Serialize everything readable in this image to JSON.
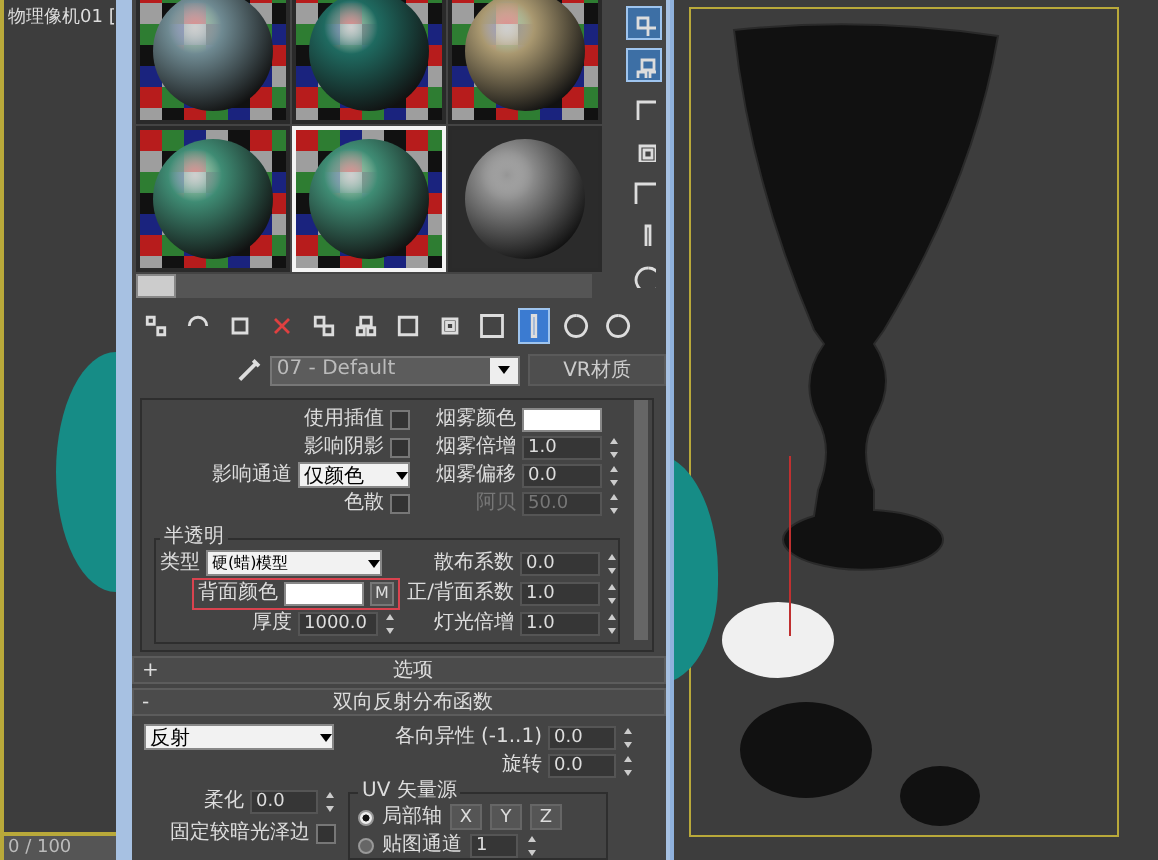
{
  "left_viewport": {
    "label": "物理像机01 [",
    "frame_counter": "0 / 100"
  },
  "material_editor": {
    "sample_slots": [
      {
        "kind": "checker",
        "color": "#6f8a92",
        "selected": false
      },
      {
        "kind": "checker",
        "color": "#1f6a60",
        "selected": false
      },
      {
        "kind": "checker",
        "color": "#a99870",
        "selected": false
      },
      {
        "kind": "checker",
        "color": "#3f8c74",
        "selected": false
      },
      {
        "kind": "checker",
        "color": "#3f8c74",
        "selected": true
      },
      {
        "kind": "plain",
        "color": "#8a8a8a",
        "selected": false
      }
    ],
    "side_toolbar": [
      {
        "selected": true
      },
      {
        "selected": true
      },
      {
        "selected": false
      },
      {
        "selected": false
      },
      {
        "selected": false
      },
      {
        "selected": false
      },
      {
        "selected": false
      }
    ],
    "toolbar": [
      {
        "selected": false
      },
      {
        "selected": false
      },
      {
        "selected": false
      },
      {
        "selected": false
      },
      {
        "selected": false
      },
      {
        "selected": false
      },
      {
        "selected": false
      },
      {
        "selected": false
      },
      {
        "selected": false
      },
      {
        "selected": true
      },
      {
        "selected": false
      },
      {
        "selected": false
      }
    ],
    "material_name": "07 - Default",
    "material_type": "VR材质",
    "fog": {
      "use_interpolation": {
        "label": "使用插值",
        "checked": false
      },
      "affect_shadows": {
        "label": "影响阴影",
        "checked": false
      },
      "affect_channels": {
        "label": "影响通道",
        "value": "仅颜色"
      },
      "dispersion": {
        "label": "色散",
        "checked": false
      },
      "fog_color": {
        "label": "烟雾颜色"
      },
      "fog_multiplier": {
        "label": "烟雾倍增",
        "value": "1.0"
      },
      "fog_bias": {
        "label": "烟雾偏移",
        "value": "0.0"
      },
      "abbe": {
        "label": "阿贝",
        "value": "50.0",
        "disabled": true
      }
    },
    "translucency": {
      "title": "半透明",
      "type_label": "类型",
      "type_value": "硬(蜡)模型",
      "back_color_label": "背面颜色",
      "map_button": "M",
      "thickness_label": "厚度",
      "thickness": "1000.0",
      "scatter_label": "散布系数",
      "scatter": "0.0",
      "front_back_label": "正/背面系数",
      "front_back": "1.0",
      "light_label": "灯光倍增",
      "light": "1.0"
    },
    "rollouts": [
      {
        "sign": "+",
        "title": "选项"
      },
      {
        "sign": "-",
        "title": "双向反射分布函数"
      }
    ],
    "brdf": {
      "type": "反射",
      "anisotropy_label": "各向异性 (-1..1)",
      "anisotropy": "0.0",
      "rotation_label": "旋转",
      "rotation": "0.0",
      "soften_label": "柔化",
      "soften": "0.0",
      "fix_dark_label": "固定较暗光泽边",
      "fix_dark_checked": false,
      "uv_title": "UV 矢量源",
      "uv_options": [
        {
          "label": "局部轴",
          "selected": true
        },
        {
          "label": "贴图通道",
          "selected": false
        }
      ],
      "axes": [
        "X",
        "Y",
        "Z"
      ],
      "channel": "1"
    }
  }
}
